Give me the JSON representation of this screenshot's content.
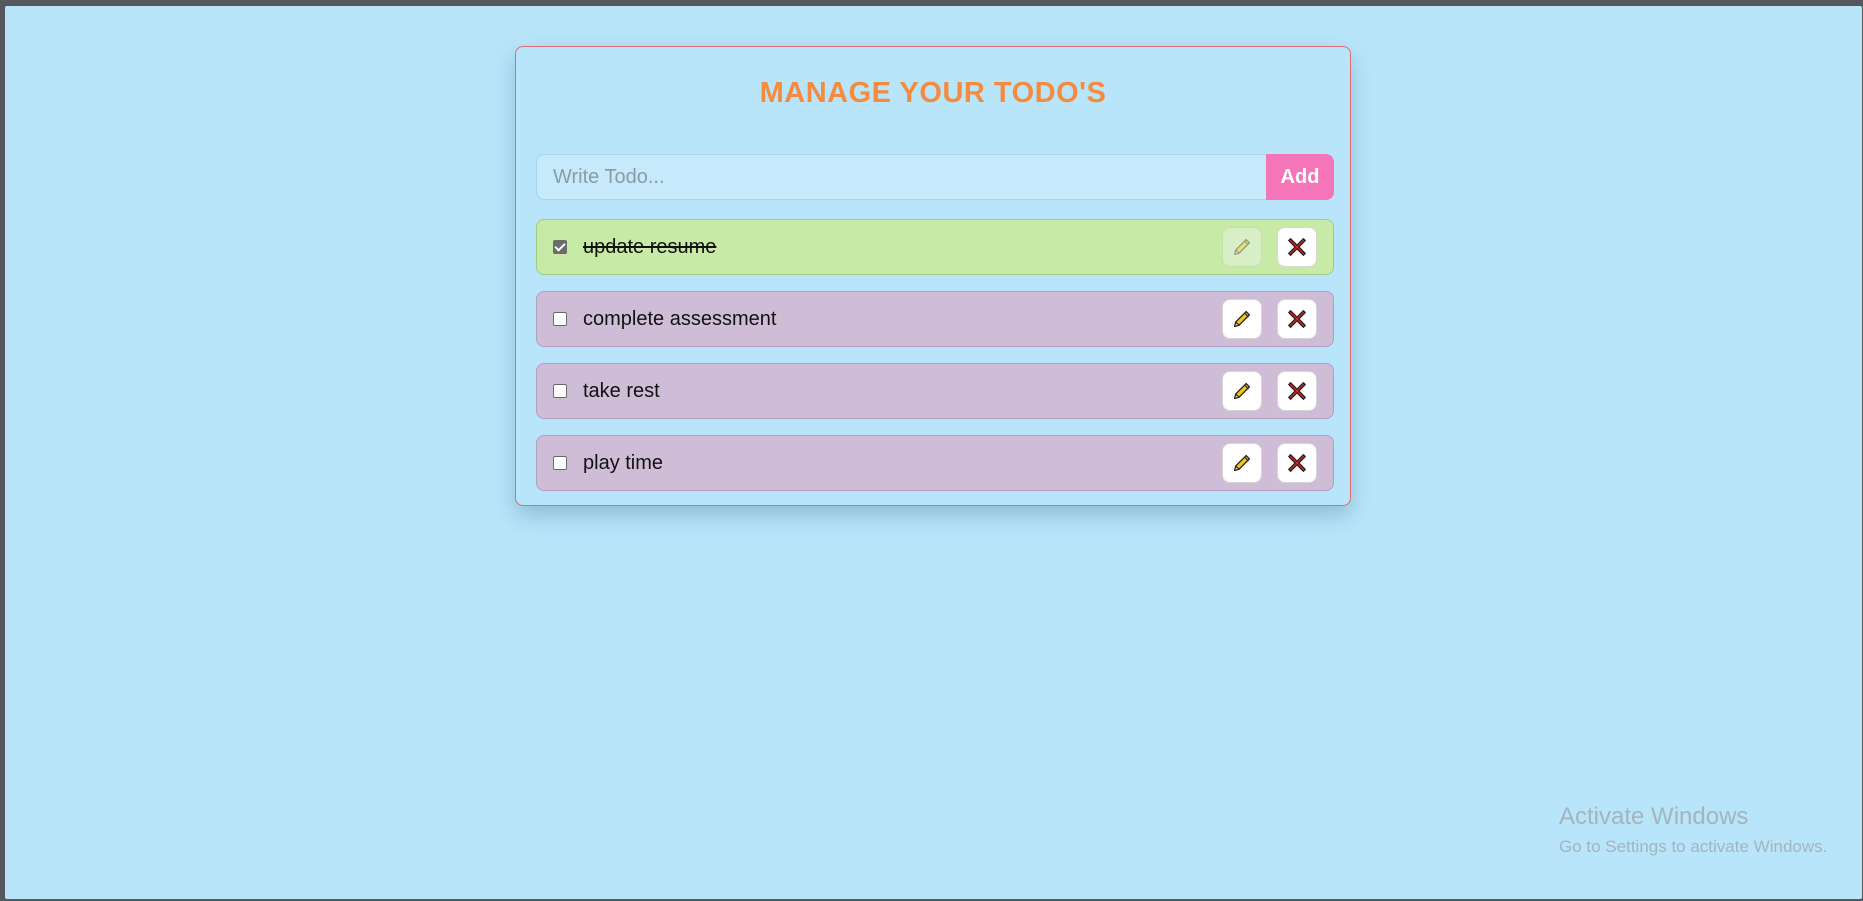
{
  "app": {
    "title": "MANAGE YOUR TODO'S"
  },
  "input": {
    "placeholder": "Write Todo...",
    "value": "",
    "add_label": "Add"
  },
  "todos": [
    {
      "text": "update resume",
      "completed": true
    },
    {
      "text": "complete assessment",
      "completed": false
    },
    {
      "text": "take rest",
      "completed": false
    },
    {
      "text": "play time",
      "completed": false
    }
  ],
  "icons": {
    "edit": "pencil-icon",
    "delete": "cross-icon"
  },
  "colors": {
    "background": "#b9e5fa",
    "title": "#f58b3f",
    "add_button": "#f476b8",
    "completed_item": "#c7eaa7",
    "pending_item": "#cfbdd7",
    "card_border": "#e06b73"
  },
  "watermark": {
    "line1": "Activate Windows",
    "line2": "Go to Settings to activate Windows."
  }
}
